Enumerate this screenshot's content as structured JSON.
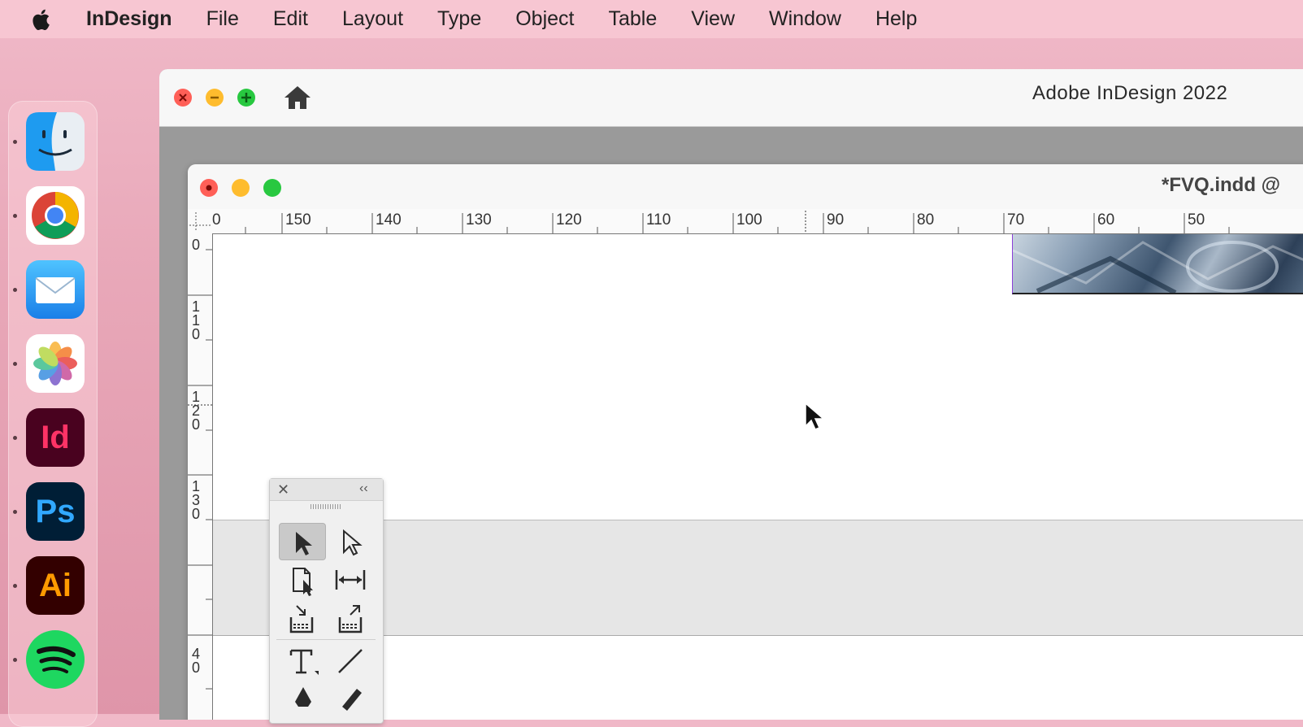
{
  "menubar": {
    "apple_icon": "apple-logo-icon",
    "app_name": "InDesign",
    "items": [
      "File",
      "Edit",
      "Layout",
      "Type",
      "Object",
      "Table",
      "View",
      "Window",
      "Help"
    ]
  },
  "dock": {
    "apps": [
      {
        "name": "Finder",
        "icon": "finder-icon"
      },
      {
        "name": "Google Chrome",
        "icon": "chrome-icon"
      },
      {
        "name": "Mail",
        "icon": "mail-icon"
      },
      {
        "name": "Photos",
        "icon": "photos-icon"
      },
      {
        "name": "InDesign",
        "icon": "indesign-icon",
        "label": "Id",
        "color": "#ff3366",
        "bg": "#49021f"
      },
      {
        "name": "Photoshop",
        "icon": "photoshop-icon",
        "label": "Ps",
        "color": "#31a8ff",
        "bg": "#001e36"
      },
      {
        "name": "Illustrator",
        "icon": "illustrator-icon",
        "label": "Ai",
        "color": "#ff9a00",
        "bg": "#330000"
      },
      {
        "name": "Spotify",
        "icon": "spotify-icon"
      }
    ]
  },
  "app_window": {
    "title": "Adobe InDesign 2022",
    "home_icon": "home-icon"
  },
  "document": {
    "title": "*FVQ.indd @",
    "h_ruler_labels": [
      "0",
      "150",
      "140",
      "130",
      "120",
      "110",
      "100",
      "90",
      "80",
      "70",
      "60",
      "50"
    ],
    "v_ruler_labels": [
      [
        "0"
      ],
      [
        "1",
        "1",
        "0"
      ],
      [
        "1",
        "2",
        "0"
      ],
      [
        "1",
        "3",
        "0"
      ],
      [
        "4",
        "0"
      ]
    ]
  },
  "tools_panel": {
    "close_label": "✕",
    "collapse_label": "‹‹",
    "tools": [
      {
        "name": "selection-tool",
        "active": true
      },
      {
        "name": "direct-selection-tool",
        "active": false
      },
      {
        "name": "page-tool",
        "active": false
      },
      {
        "name": "gap-tool",
        "active": false
      },
      {
        "name": "content-collector-tool",
        "active": false
      },
      {
        "name": "content-placer-tool",
        "active": false
      },
      {
        "name": "type-tool",
        "active": false
      },
      {
        "name": "line-tool",
        "active": false
      },
      {
        "name": "pen-tool",
        "active": false
      },
      {
        "name": "pencil-tool",
        "active": false
      }
    ]
  },
  "colors": {
    "menubar_bg": "#f7c6d2",
    "desktop_bg": "#e8a7b8",
    "close": "#ff5f57",
    "minimize": "#febc2e",
    "zoom": "#28c840",
    "frame_selection": "#8a3fd8"
  }
}
